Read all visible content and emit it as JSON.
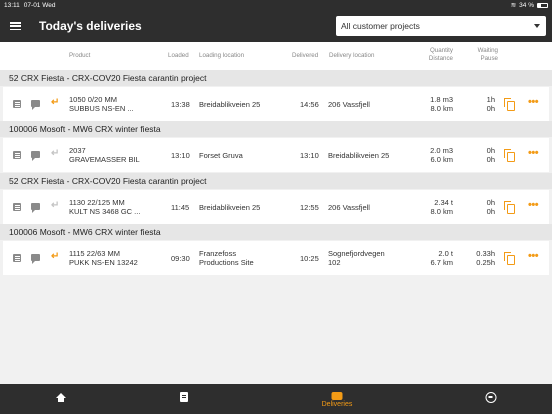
{
  "status": {
    "time": "13:11",
    "date": "07-01 Wed",
    "battery": "34 %"
  },
  "appbar": {
    "title": "Today's deliveries",
    "project_filter": "All customer projects"
  },
  "columns": {
    "product": "Product",
    "loaded": "Loaded",
    "loading_location": "Loading location",
    "delivered": "Delivered",
    "delivery_location": "Delivery location",
    "quantity": "Quantity",
    "distance": "Distance",
    "waiting": "Waiting",
    "pause": "Pause"
  },
  "groups": [
    {
      "title": "52 CRX Fiesta - CRX-COV20 Fiesta carantin project",
      "row": {
        "product_line1": "1050 0/20 MM",
        "product_line2": "SUBBUS NS-EN ...",
        "loaded": "13:38",
        "loading_location": "Breidablikveien 25",
        "loading_location_line2": "",
        "delivered": "14:56",
        "delivery_location": "206 Vassfjell",
        "delivery_location_line2": "",
        "quantity": "1.8 m3",
        "distance": "8.0 km",
        "waiting": "1h",
        "pause": "0h",
        "return_active": true
      }
    },
    {
      "title": "100006 Mosoft - MW6 CRX winter fiesta",
      "row": {
        "product_line1": "2037",
        "product_line2": "GRAVEMASSER BIL",
        "loaded": "13:10",
        "loading_location": "Forset Gruva",
        "loading_location_line2": "",
        "delivered": "13:10",
        "delivery_location": "Breidablikveien 25",
        "delivery_location_line2": "",
        "quantity": "2.0 m3",
        "distance": "6.0 km",
        "waiting": "0h",
        "pause": "0h",
        "return_active": false
      }
    },
    {
      "title": "52 CRX Fiesta - CRX-COV20 Fiesta carantin project",
      "row": {
        "product_line1": "1130 22/125 MM",
        "product_line2": "KULT NS 3468 GC ...",
        "loaded": "11:45",
        "loading_location": "Breidablikveien 25",
        "loading_location_line2": "",
        "delivered": "12:55",
        "delivery_location": "206 Vassfjell",
        "delivery_location_line2": "",
        "quantity": "2.34 t",
        "distance": "8.0 km",
        "waiting": "0h",
        "pause": "0h",
        "return_active": false
      }
    },
    {
      "title": "100006 Mosoft - MW6 CRX winter fiesta",
      "row": {
        "product_line1": "1115 22/63 MM",
        "product_line2": "PUKK NS-EN 13242",
        "loaded": "09:30",
        "loading_location": "Franzefoss",
        "loading_location_line2": "Productions Site",
        "delivered": "10:25",
        "delivery_location": "Sognefjordvegen",
        "delivery_location_line2": "102",
        "quantity": "2.0 t",
        "distance": "6.7 km",
        "waiting": "0.33h",
        "pause": "0.25h",
        "return_active": true
      }
    }
  ],
  "bottomnav": {
    "active_label": "Deliveries"
  },
  "icons": [
    "menu-icon",
    "chevron-down-icon",
    "document-icon",
    "chat-icon",
    "return-arrow-icon",
    "copy-icon",
    "more-icon",
    "home-icon",
    "clipboard-icon",
    "truck-icon",
    "steering-wheel-icon"
  ],
  "colors": {
    "accent": "#f39b16",
    "appbar": "#2e2e2e"
  }
}
